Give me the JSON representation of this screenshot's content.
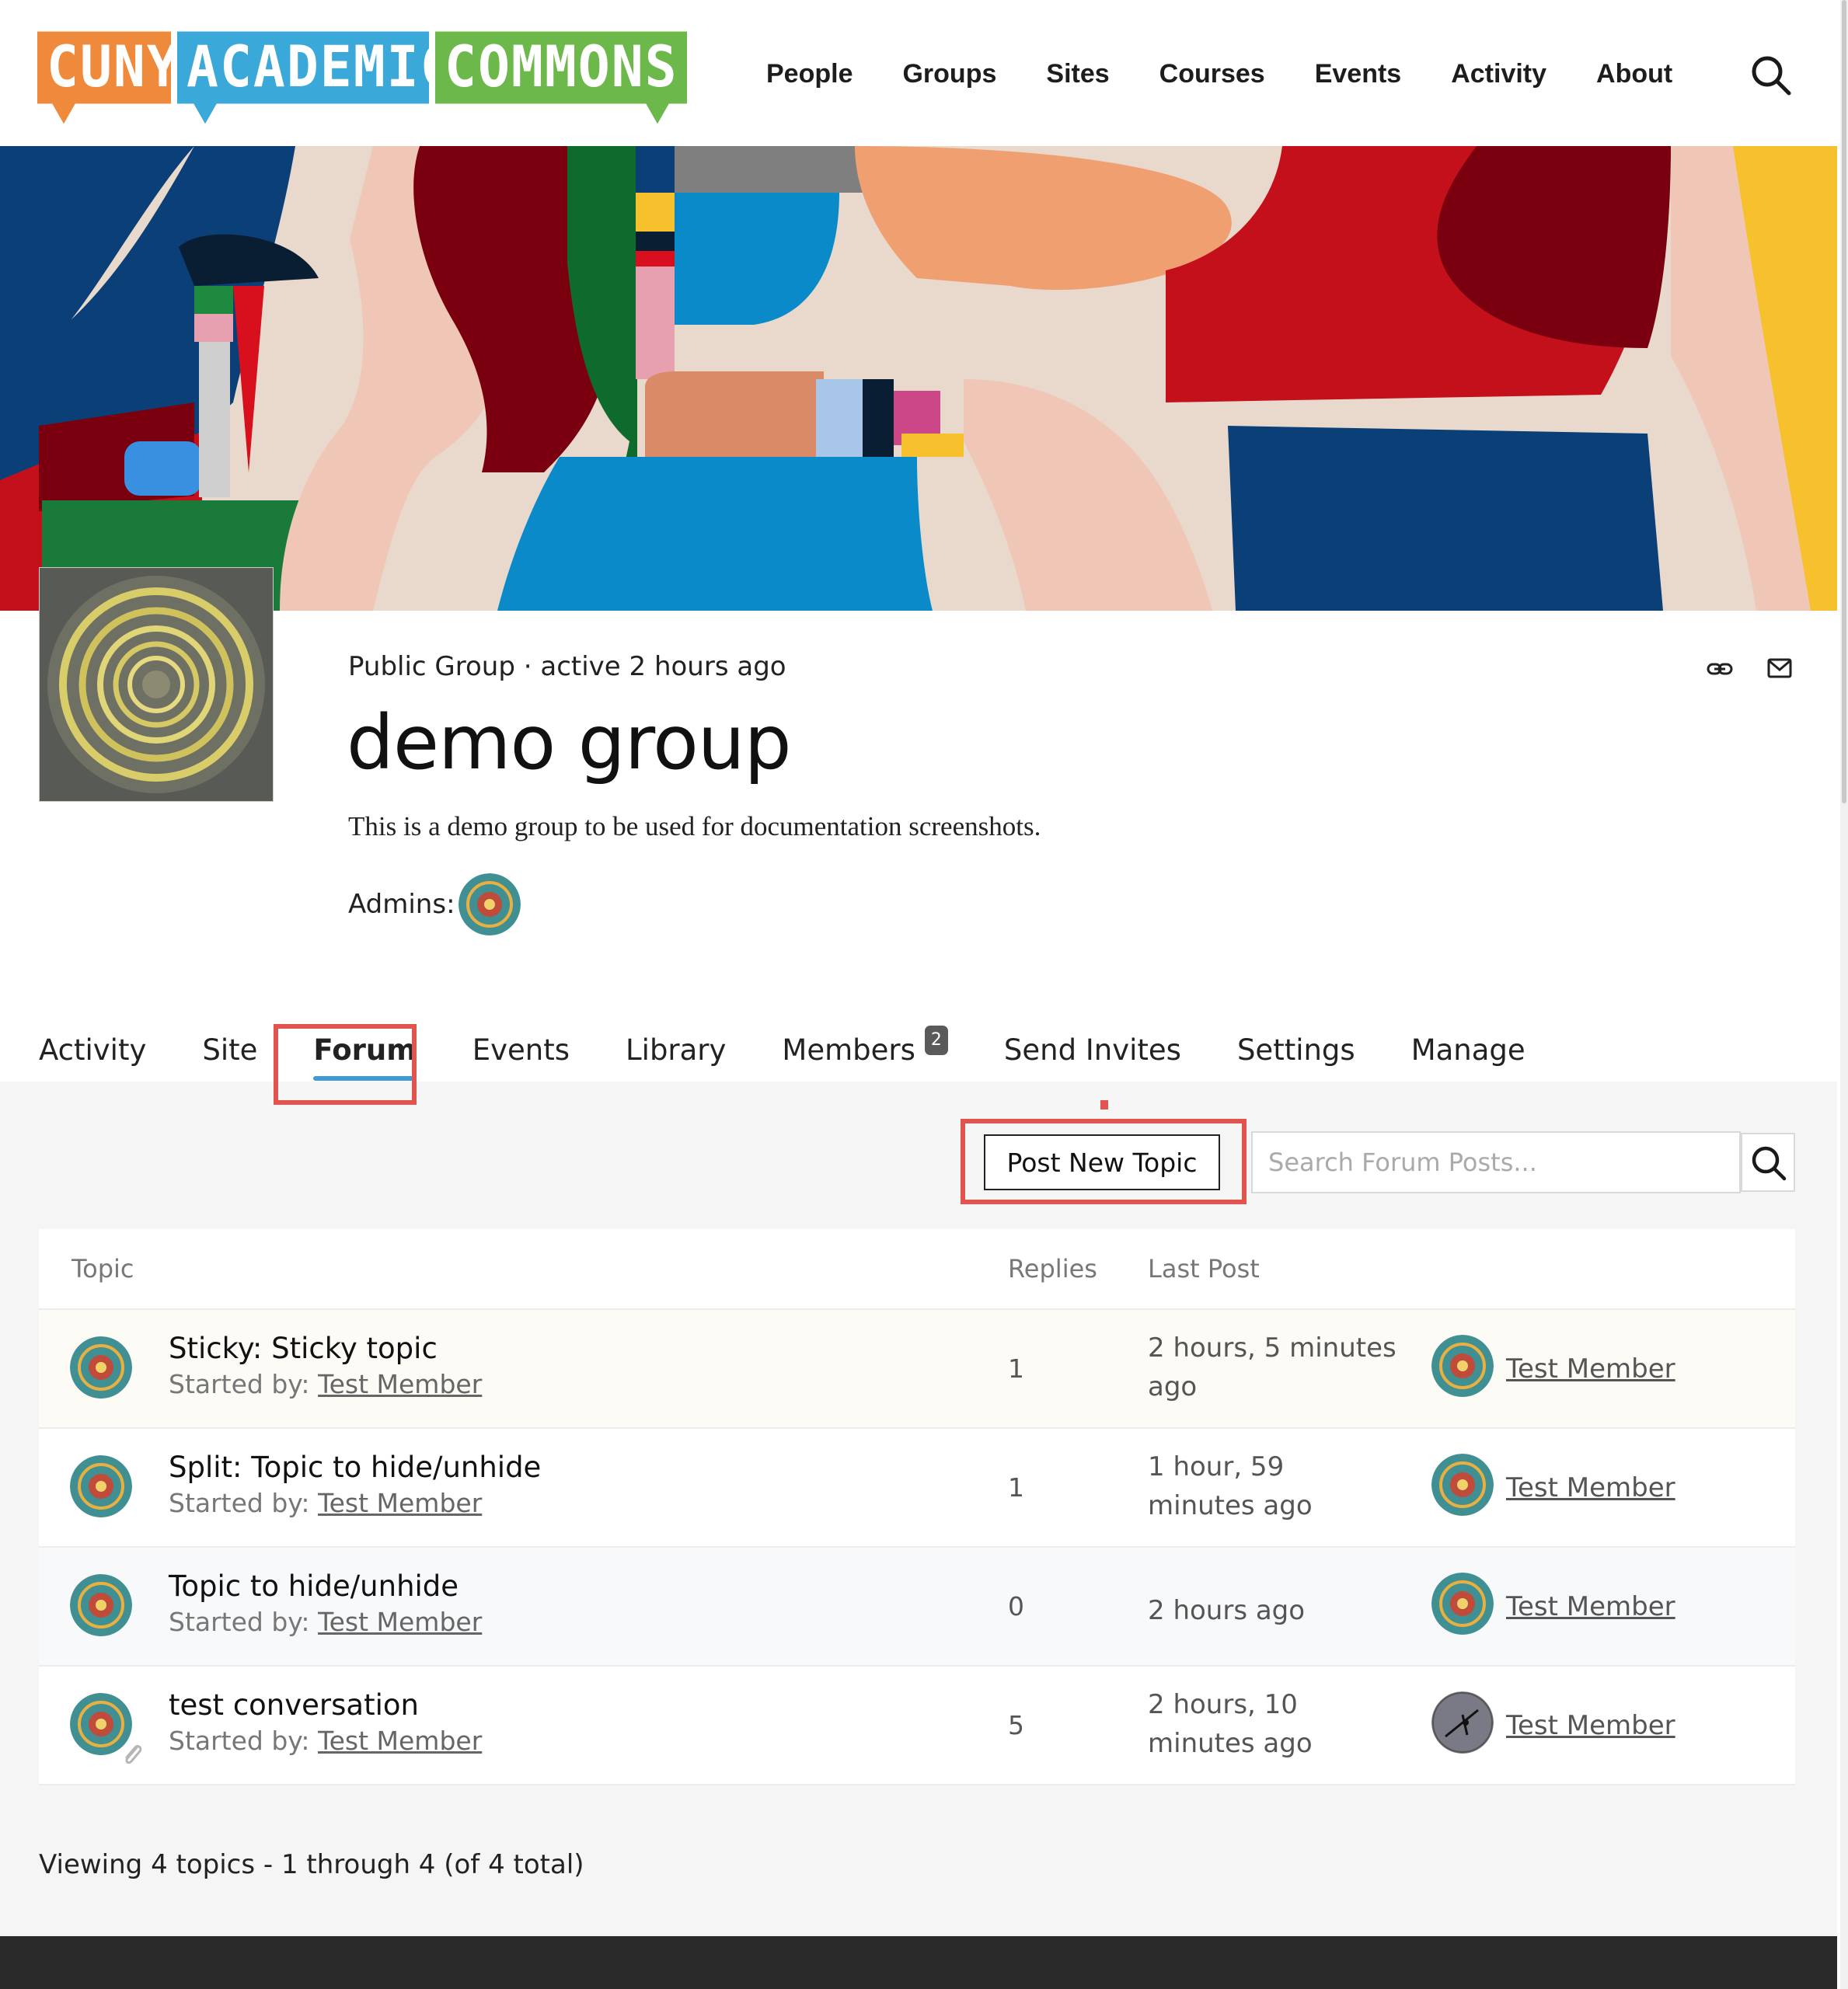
{
  "logo": {
    "part1": "CUNY",
    "part2": "ACADEMIC",
    "part3": "COMMONS"
  },
  "nav": [
    "People",
    "Groups",
    "Sites",
    "Courses",
    "Events",
    "Activity",
    "About"
  ],
  "group": {
    "meta": "Public Group · active 2 hours ago",
    "title": "demo group",
    "description": "This is a demo group to be used for documentation screenshots.",
    "admins_label": "Admins:"
  },
  "tabs": {
    "activity": "Activity",
    "site": "Site",
    "forum": "Forum",
    "events": "Events",
    "library": "Library",
    "members": "Members",
    "members_count": "2",
    "send_invites": "Send Invites",
    "settings": "Settings",
    "manage": "Manage"
  },
  "forum": {
    "post_button": "Post New Topic",
    "search_placeholder": "Search Forum Posts...",
    "columns": {
      "topic": "Topic",
      "replies": "Replies",
      "last_post": "Last Post"
    },
    "started_by": "Started by:",
    "topics": [
      {
        "title": "Sticky: Sticky topic",
        "author": "Test Member",
        "replies": "1",
        "last_post": "2 hours, 5 minutes ago",
        "last_user": "Test Member"
      },
      {
        "title": "Split: Topic to hide/unhide",
        "author": "Test Member",
        "replies": "1",
        "last_post": "1 hour, 59 minutes ago",
        "last_user": "Test Member"
      },
      {
        "title": "Topic to hide/unhide",
        "author": "Test Member",
        "replies": "0",
        "last_post": "2 hours ago",
        "last_user": "Test Member"
      },
      {
        "title": "test conversation",
        "author": "Test Member",
        "replies": "5",
        "last_post": "2 hours, 10 minutes ago",
        "last_user": "Test Member"
      }
    ],
    "viewing": "Viewing 4 topics - 1 through 4 (of 4 total)"
  },
  "colors": {
    "accent": "#3f9bd6",
    "highlight": "#e2544e",
    "footer": "#2a2a2a"
  },
  "icons": [
    "search-icon",
    "link-icon",
    "mail-icon",
    "paperclip-icon"
  ]
}
